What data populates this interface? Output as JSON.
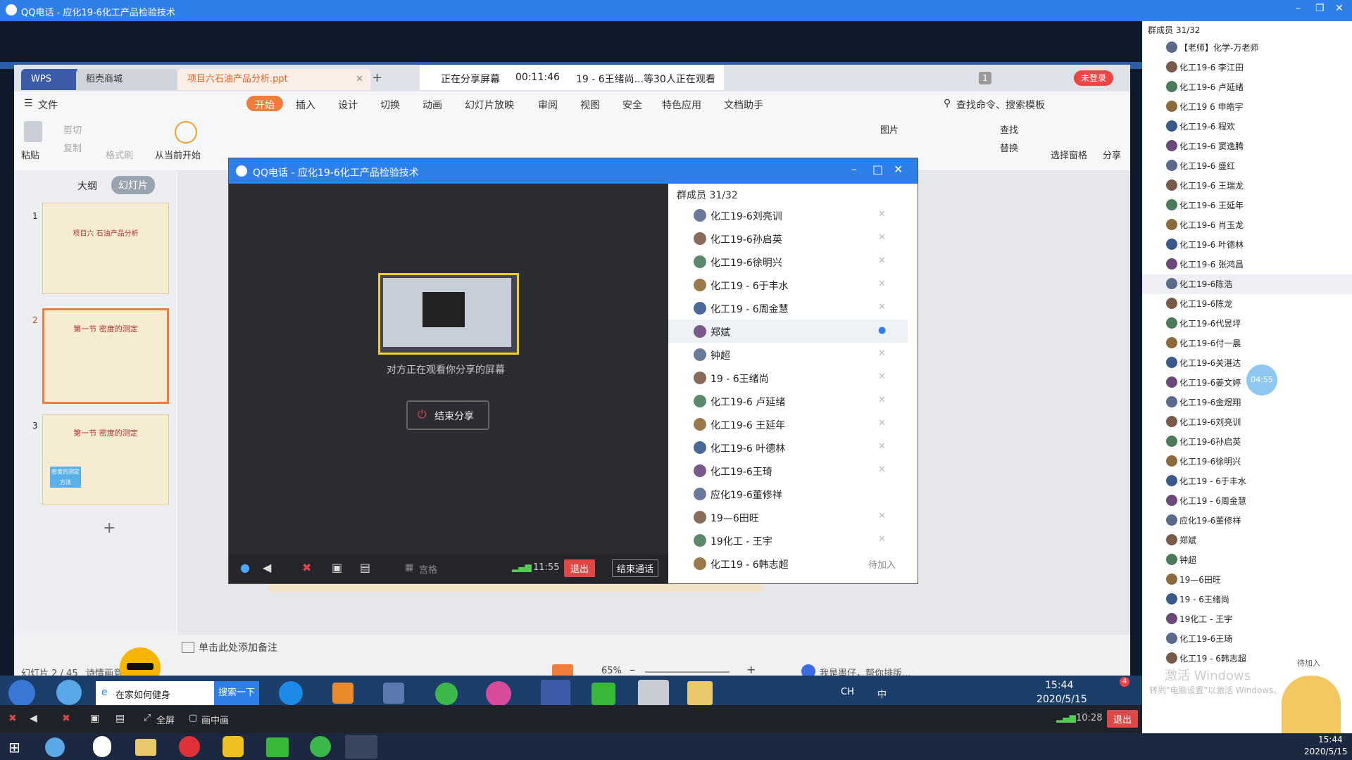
{
  "outer_window": {
    "title": "QQ电话 - 应化19-6化工产品检验技术",
    "minimize": "–",
    "restore": "❐",
    "close": "✕"
  },
  "share_bar": {
    "status": "正在分享屏幕",
    "elapsed": "00:11:46",
    "watchers": "19 - 6王绪尚...等30人正在观看"
  },
  "wps": {
    "tabs": [
      {
        "label": "WPS"
      },
      {
        "label": "稻壳商城"
      },
      {
        "label": "项目六石油产品分析.ppt"
      }
    ],
    "new_tab": "+",
    "badge": "1",
    "login_button": "未登录",
    "menu": [
      {
        "label": "文件"
      },
      {
        "label": "开始"
      },
      {
        "label": "插入"
      },
      {
        "label": "设计"
      },
      {
        "label": "切换"
      },
      {
        "label": "动画"
      },
      {
        "label": "幻灯片放映"
      },
      {
        "label": "审阅"
      },
      {
        "label": "视图"
      },
      {
        "label": "安全"
      },
      {
        "label": "特色应用"
      },
      {
        "label": "文档助手"
      }
    ],
    "search_cmd": "查找命令、搜索模板",
    "ribbon": {
      "paste": "粘贴",
      "cut": "剪切",
      "copy": "复制",
      "format_painter": "格式刷",
      "from_current": "从当前开始",
      "picture": "图片",
      "find": "查找",
      "replace": "替换",
      "select_pane": "选择窗格",
      "share": "分享"
    },
    "view_tabs": {
      "outline": "大纲",
      "slides": "幻灯片"
    },
    "slides": [
      {
        "num": "1",
        "title": "项目六  石油产品分析"
      },
      {
        "num": "2",
        "title": "第一节  密度的测定"
      },
      {
        "num": "3",
        "title": "第一节  密度的测定"
      }
    ],
    "slide3_box": "密度的测定方法",
    "add_slide": "+",
    "notes_placeholder": "单击此处添加备注",
    "slide_counter": "幻灯片 2 / 45",
    "theme_label": "诗情画意",
    "zoom": "65%",
    "assistant": "我是墨仔，帮你排版..."
  },
  "remote_taskbar": {
    "search_text": "在家如何健身",
    "search_button": "搜索一下",
    "tray_lang": "CH",
    "tray_ime": "中",
    "time": "15:44",
    "date": "2020/5/15",
    "notif": "4"
  },
  "qq_dialog": {
    "title": "QQ电话 - 应化19-6化工产品检验技术",
    "preview_caption": "对方正在观看你分享的屏幕",
    "end_share": "结束分享",
    "grid_label": "宫格",
    "time": "11:55",
    "exit_button": "退出",
    "end_call": "结束通话",
    "member_header": "群成员 31/32",
    "members": [
      {
        "name": "化工19-6刘亮训",
        "state": "muted"
      },
      {
        "name": "化工19-6孙启英",
        "state": "muted"
      },
      {
        "name": "化工19-6徐明兴",
        "state": "muted"
      },
      {
        "name": "化工19 - 6于丰水",
        "state": "muted"
      },
      {
        "name": "化工19 - 6周金慧",
        "state": "muted"
      },
      {
        "name": "郑斌",
        "state": "speaking"
      },
      {
        "name": "钟超",
        "state": "muted"
      },
      {
        "name": "19 - 6王绪尚",
        "state": "muted"
      },
      {
        "name": "化工19-6 卢延绪",
        "state": "muted"
      },
      {
        "name": "化工19-6 王延年",
        "state": "muted"
      },
      {
        "name": "化工19-6 叶德林",
        "state": "muted"
      },
      {
        "name": "化工19-6王琦",
        "state": "muted"
      },
      {
        "name": "应化19-6董修祥",
        "state": "none"
      },
      {
        "name": "19—6田旺",
        "state": "muted"
      },
      {
        "name": "19化工 - 王宇",
        "state": "muted"
      },
      {
        "name": "化工19 - 6韩志超",
        "state": "waiting"
      }
    ],
    "waiting_label": "待加入"
  },
  "right_panel": {
    "header": "群成员 31/32",
    "members": [
      {
        "name": "【老师】化学-万老师"
      },
      {
        "name": "化工19-6 李江田"
      },
      {
        "name": "化工19-6 卢延绪"
      },
      {
        "name": "化工19 6 申皓宇"
      },
      {
        "name": "化工19-6 程欢"
      },
      {
        "name": "化工19-6 窦逸腾"
      },
      {
        "name": "化工19-6 盛红"
      },
      {
        "name": "化工19-6 王瑞龙"
      },
      {
        "name": "化工19-6 王延年"
      },
      {
        "name": "化工19-6 肖玉龙"
      },
      {
        "name": "化工19-6 叶德林"
      },
      {
        "name": "化工19-6 张鸿昌"
      },
      {
        "name": "化工19-6陈浩"
      },
      {
        "name": "化工19-6陈龙"
      },
      {
        "name": "化工19-6代昱坪"
      },
      {
        "name": "化工19-6付一晨"
      },
      {
        "name": "化工19-6关湛达"
      },
      {
        "name": "化工19-6姜文婷"
      },
      {
        "name": "化工19-6金煜翔"
      },
      {
        "name": "化工19-6刘亮训"
      },
      {
        "name": "化工19-6孙启英"
      },
      {
        "name": "化工19-6徐明兴"
      },
      {
        "name": "化工19 - 6于丰水"
      },
      {
        "name": "化工19 - 6周金慧"
      },
      {
        "name": "应化19-6董修祥"
      },
      {
        "name": "郑斌"
      },
      {
        "name": "钟超"
      },
      {
        "name": "19—6田旺"
      },
      {
        "name": "19 - 6王绪尚"
      },
      {
        "name": "19化工 - 王宇"
      },
      {
        "name": "化工19-6王琦"
      },
      {
        "name": "化工19 - 6韩志超"
      }
    ],
    "waiting_label": "待加入",
    "bubble_time": "04:55",
    "activate_title": "激活 Windows",
    "activate_sub": "转到\"电脑设置\"以激活 Windows。"
  },
  "control_bar": {
    "fullscreen": "全屏",
    "pip": "画中画",
    "time": "10:28",
    "exit_button": "退出"
  },
  "taskbar": {
    "time": "15:44",
    "date": "2020/5/15"
  },
  "colors": {
    "qq_blue": "#2f7fe8",
    "exit_red": "#e04848",
    "wps_orange": "#f07d3c"
  }
}
